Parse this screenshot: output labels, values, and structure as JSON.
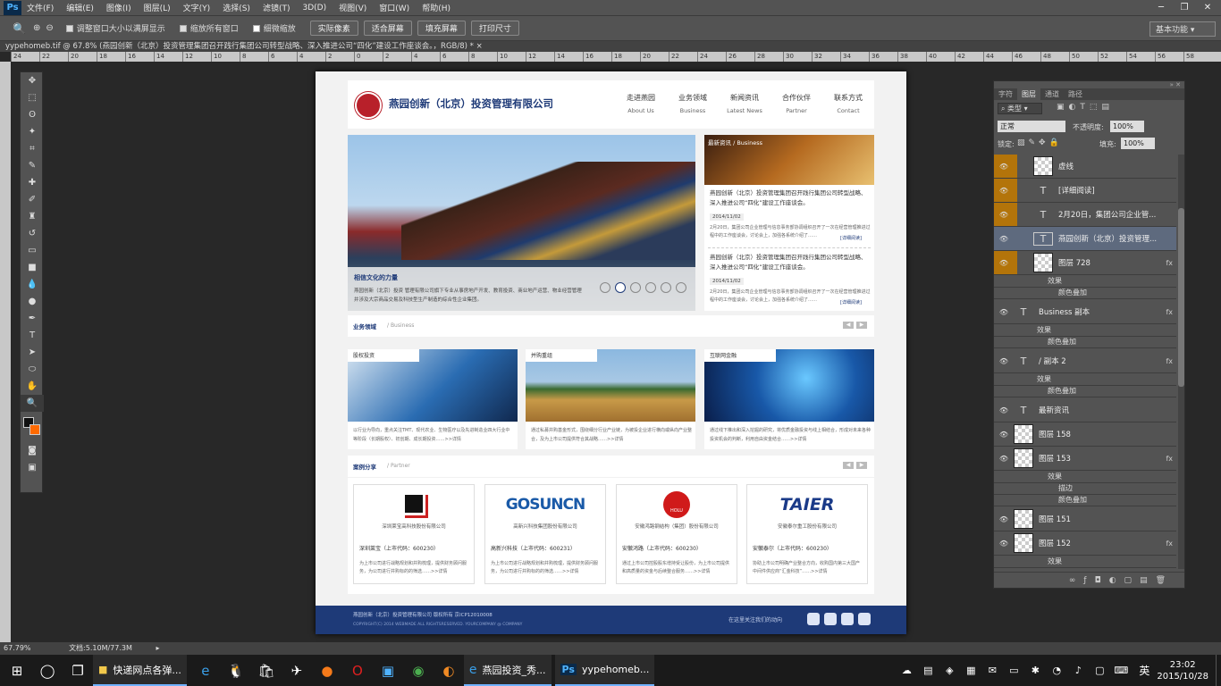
{
  "menubar": {
    "app_icon": "Ps",
    "items": [
      "文件(F)",
      "编辑(E)",
      "图像(I)",
      "图层(L)",
      "文字(Y)",
      "选择(S)",
      "滤镜(T)",
      "3D(D)",
      "视图(V)",
      "窗口(W)",
      "帮助(H)"
    ]
  },
  "options": {
    "resize_window": "调整窗口大小以满屏显示",
    "zoom_all": "缩放所有窗口",
    "scrubby_zoom": "细微缩放",
    "btn_actual": "实际像素",
    "btn_fit": "适合屏幕",
    "btn_fill": "填充屏幕",
    "btn_print": "打印尺寸",
    "workspace": "基本功能"
  },
  "doc_tab": "yypehomeb.tif @ 67.8% (燕园创新（北京）投资管理集团召开践行集团公司转型战略、深入推进公司“四化”建设工作座谈会。，RGB/8) *",
  "ruler_marks": [
    "24",
    "22",
    "20",
    "18",
    "16",
    "14",
    "12",
    "10",
    "8",
    "6",
    "4",
    "2",
    "0",
    "2",
    "4",
    "6",
    "8",
    "10",
    "12",
    "14",
    "16",
    "18",
    "20",
    "22",
    "24",
    "26",
    "28",
    "30",
    "32",
    "34",
    "36",
    "38",
    "40",
    "42",
    "44",
    "46",
    "48",
    "50",
    "52",
    "54",
    "56",
    "58"
  ],
  "status": {
    "zoom": "67.79%",
    "doc": "文档:5.10M/77.3M"
  },
  "site": {
    "company": "燕园创新（北京）投资管理有限公司",
    "nav": [
      {
        "cn": "走进燕园",
        "en": "About Us"
      },
      {
        "cn": "业务领域",
        "en": "Business"
      },
      {
        "cn": "新闻资讯",
        "en": "Latest News"
      },
      {
        "cn": "合作伙伴",
        "en": "Partner"
      },
      {
        "cn": "联系方式",
        "en": "Contact"
      }
    ],
    "banner_title": "相信文化的力量",
    "banner_desc": "燕园创新（北京）投资 管理有限公司旗下专业从事房地产开发、教育投资、商业地产运营、物业经营管理并涉及大宗商品交易及科技型生产制造的综合性企业集团。",
    "news_tag": "最新资讯",
    "news_tag_en": "Business",
    "news_items": [
      {
        "title": "燕园创新（北京）投资管理集团召开践行集团公司转型战略、深入推进公司“四化”建设工作座谈会。",
        "date": "2014/11/02",
        "desc": "2月20日，集团公司企业管理与信息事务部协调组织召开了一次在经营管理推进过程中的工作座谈会，讨论会上，加强各系统介绍了……",
        "more": "[详细阅读]"
      },
      {
        "title": "燕园创新（北京）投资管理集团召开践行集团公司转型战略、深入推进公司“四化”建设工作座谈会。",
        "date": "2014/11/02",
        "desc": "2月20日，集团公司企业管理与信息事务部协调组织召开了一次在经营管理推进过程中的工作座谈会，讨论会上，加强各系统介绍了……",
        "more": "[详细阅读]"
      }
    ],
    "biz_title": "业务领域",
    "biz_en": "Business",
    "cards": [
      {
        "label": "股权投资",
        "desc": "以行业为导向，重点关注TMT、现代农业、生物医疗以及先进制造业四大行业中等阶段（长期股权）、初创期、成长期投资……>>详情"
      },
      {
        "label": "并购重组",
        "desc": "通过私募并购基金形式，围绕细分行业产业链，为被投企业进行横向或纵向产业整合，及为上市公司提供符合其战略……>>详情"
      },
      {
        "label": "互联网金融",
        "desc": "通过线下推出和深入挖掘的研究，将优质金融投资与线上相结合，形成对未来各种投资机会的判断，利用自由资金结合……>>详情"
      }
    ],
    "case_title": "案例分享",
    "case_en": "Partner",
    "cases": [
      {
        "name": "深圳莱宝高科技股份有限公司",
        "sub": "深圳莱宝（上市代码：600230）",
        "desc": "为上市公司进行战略规划和并购梳理，提供财务顾问服务，为公司进行并购标的的筛选……>>详情"
      },
      {
        "name": "高新兴科技集团股份有限公司",
        "sub": "高新兴科技（上市代码：600231）",
        "desc": "为上市公司进行战略规划和并购梳理，提供财务顾问服务，为公司进行并购标的的筛选……>>详情"
      },
      {
        "name": "安徽鸿路钢结构（集团）股份有限公司",
        "sub": "安徽鸿路（上市代码：600230）",
        "desc": "通过上市公司控股股东增持受让股份，为上市公司提供和高质量的资金与后续整合服务……>>详情"
      },
      {
        "name": "安徽泰尔重工股份有限公司",
        "sub": "安徽泰尔（上市代码：600230）",
        "desc": "协助上市公司明确产业整合方向，收购国内第三大国产中间件供应商“汇金科技”……>>详情"
      }
    ],
    "footer_line1": "燕园创新（北京）投资管理有限公司  版权所有  京ICP12010008",
    "footer_line2": "COPYRIGHT(C) 2014 WEBMADE ALL RIGHTSRESERVED. YOURCOMPANY @ COMPANY",
    "footer_follow": "在这里关注我们的动向"
  },
  "layers_panel": {
    "tabs": [
      "字符",
      "图层",
      "通道",
      "路径"
    ],
    "filter": "类型",
    "blend": "正常",
    "opacity_label": "不透明度:",
    "opacity": "100%",
    "lock_label": "锁定:",
    "fill_label": "填充:",
    "fill": "100%",
    "layers": [
      "虚线",
      "[详细阅读]",
      "2月20日，集团公司企业管...",
      "燕园创新（北京）投资管理...",
      "图层 728",
      "Business 副本",
      "/ 副本 2",
      "最新资讯",
      "图层 158",
      "图层 153",
      "图层 151",
      "图层 152"
    ],
    "effects_label": "效果",
    "color_overlay": "颜色叠加",
    "stroke": "描边"
  },
  "taskbar": {
    "apps": [
      "快递网点各弹...",
      "燕园投资_秀...",
      "yypehomeb..."
    ],
    "ime": "英",
    "time": "23:02",
    "date": "2015/10/28"
  }
}
